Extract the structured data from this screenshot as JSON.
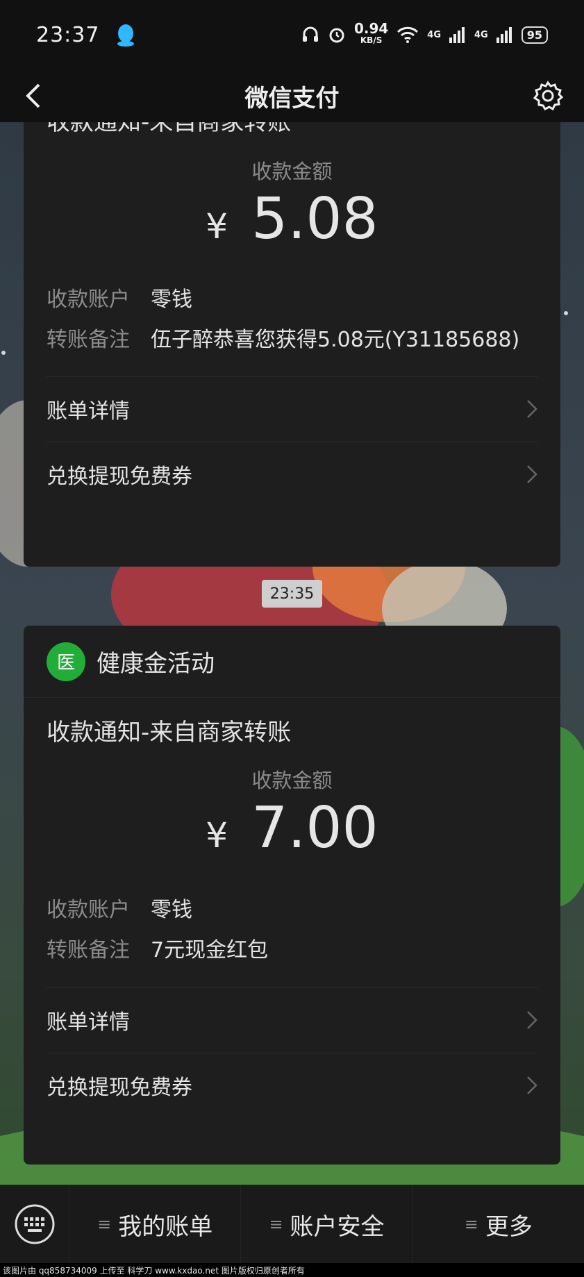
{
  "status": {
    "time": "23:37",
    "speed_value": "0.94",
    "speed_unit": "KB/S",
    "net1": "4G",
    "net2": "4G",
    "battery": "95"
  },
  "nav": {
    "title": "微信支付"
  },
  "card1": {
    "notice_title": "收款通知-来自商家转账",
    "amount_label": "收款金额",
    "currency": "¥",
    "amount": "5.08",
    "account_key": "收款账户",
    "account_value": "零钱",
    "remark_key": "转账备注",
    "remark_value": "伍子醉恭喜您获得5.08元(Y31185688)",
    "link1": "账单详情",
    "link2": "兑换提现免费券"
  },
  "timestamp": "23:35",
  "card2": {
    "icon_label": "医",
    "header_title": "健康金活动",
    "notice_title": "收款通知-来自商家转账",
    "amount_label": "收款金额",
    "currency": "¥",
    "amount": "7.00",
    "account_key": "收款账户",
    "account_value": "零钱",
    "remark_key": "转账备注",
    "remark_value": "7元现金红包",
    "link1": "账单详情",
    "link2": "兑换提现免费券"
  },
  "bottom_menu": [
    "我的账单",
    "账户安全",
    "更多"
  ],
  "watermark": "该图片由 qq858734009 上传至 科学刀 www.kxdao.net 图片版权归原创者所有"
}
